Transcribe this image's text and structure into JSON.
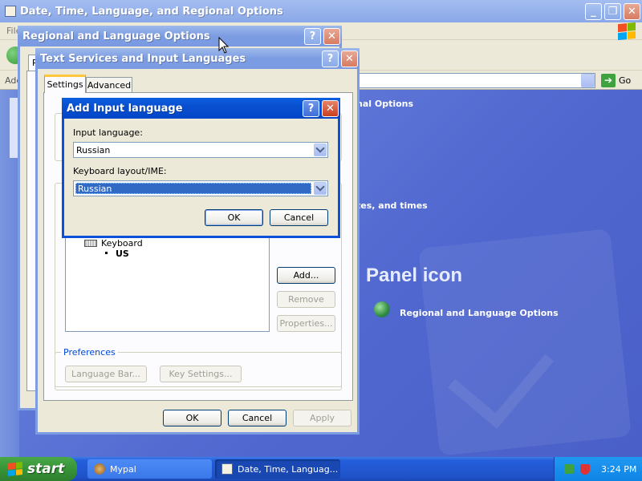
{
  "desktop": {
    "bg_color": "#5a72d8"
  },
  "explorer": {
    "title": "Date, Time, Language, and Regional Options",
    "menu_file": "File",
    "address_label": "Address",
    "go_label": "Go",
    "header_text": "nal Options",
    "task_text": "tes, and times",
    "panel_heading": "Panel icon",
    "panel_link": "Regional and Language Options"
  },
  "regional_dialog": {
    "title": "Regional and Language Options",
    "tab_partial": "R"
  },
  "text_services": {
    "title": "Text Services and Input Languages",
    "tabs": [
      "Settings",
      "Advanced"
    ],
    "keyboard_label": "Keyboard",
    "us_label": "US",
    "add_button": "Add...",
    "remove_button": "Remove",
    "properties_button": "Properties...",
    "preferences_label": "Preferences",
    "language_bar_button": "Language Bar...",
    "key_settings_button": "Key Settings...",
    "ok_button": "OK",
    "cancel_button": "Cancel",
    "apply_button": "Apply"
  },
  "add_input_dialog": {
    "title": "Add Input language",
    "input_language_label": "Input language:",
    "input_language_value": "Russian",
    "keyboard_layout_label": "Keyboard layout/IME:",
    "keyboard_layout_value": "Russian",
    "ok_button": "OK",
    "cancel_button": "Cancel"
  },
  "taskbar": {
    "start_label": "start",
    "tasks": [
      "Mypal",
      "Date, Time, Languag..."
    ],
    "clock": "3:24 PM"
  }
}
